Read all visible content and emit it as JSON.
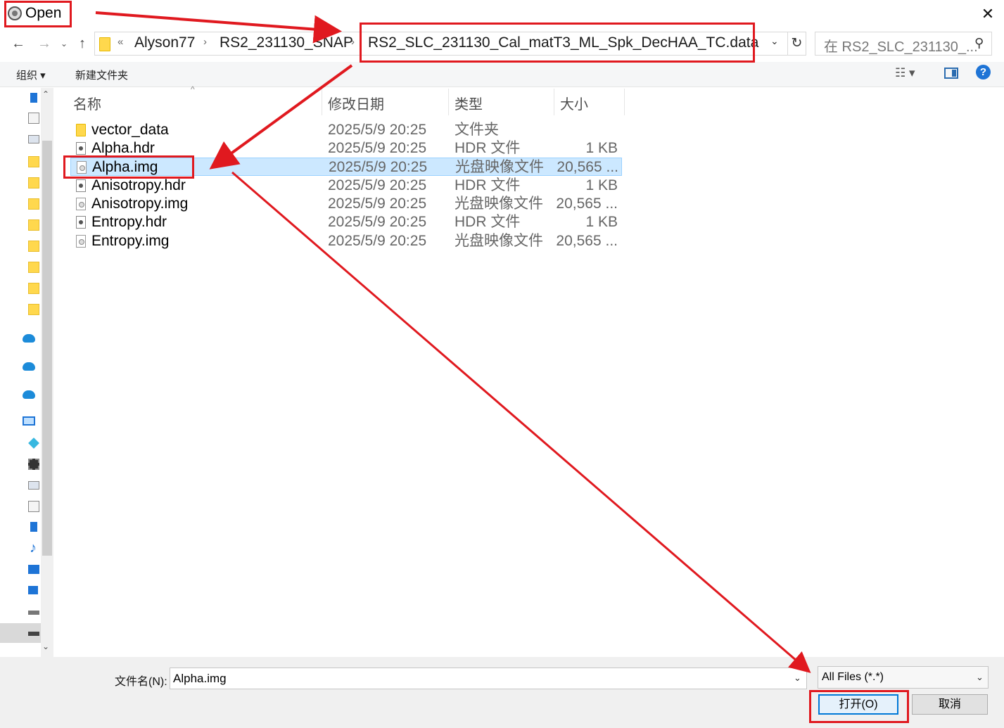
{
  "window": {
    "title": "Open",
    "close_glyph": "✕"
  },
  "nav": {
    "back_glyph": "←",
    "forward_glyph": "→",
    "recent_glyph": "⌄",
    "up_glyph": "↑"
  },
  "address": {
    "overflow": "«",
    "crumbs": [
      "Alyson77",
      "RS2_231130_SNAP",
      "RS2_SLC_231130_Cal_matT3_ML_Spk_DecHAA_TC.data"
    ],
    "separator": "›",
    "dropdown_glyph": "⌄",
    "refresh_glyph": "↻"
  },
  "search": {
    "placeholder": "在 RS2_SLC_231130_...",
    "icon": "search-icon"
  },
  "toolbar": {
    "organize_label": "组织 ▾",
    "new_folder_label": "新建文件夹",
    "view_glyph": "☷ ▾",
    "help_glyph": "?"
  },
  "columns": {
    "name": "名称",
    "date": "修改日期",
    "type": "类型",
    "size": "大小",
    "sort_glyph": "^"
  },
  "files": [
    {
      "name": "vector_data",
      "date": "2025/5/9 20:25",
      "type": "文件夹",
      "size": "",
      "icon": "folder",
      "selected": false
    },
    {
      "name": "Alpha.hdr",
      "date": "2025/5/9 20:25",
      "type": "HDR 文件",
      "size": "1 KB",
      "icon": "hdr",
      "selected": false
    },
    {
      "name": "Alpha.img",
      "date": "2025/5/9 20:25",
      "type": "光盘映像文件",
      "size": "20,565 ...",
      "icon": "img",
      "selected": true
    },
    {
      "name": "Anisotropy.hdr",
      "date": "2025/5/9 20:25",
      "type": "HDR 文件",
      "size": "1 KB",
      "icon": "hdr",
      "selected": false
    },
    {
      "name": "Anisotropy.img",
      "date": "2025/5/9 20:25",
      "type": "光盘映像文件",
      "size": "20,565 ...",
      "icon": "img",
      "selected": false
    },
    {
      "name": "Entropy.hdr",
      "date": "2025/5/9 20:25",
      "type": "HDR 文件",
      "size": "1 KB",
      "icon": "hdr",
      "selected": false
    },
    {
      "name": "Entropy.img",
      "date": "2025/5/9 20:25",
      "type": "光盘映像文件",
      "size": "20,565 ...",
      "icon": "img",
      "selected": false
    }
  ],
  "footer": {
    "filename_label": "文件名(N):",
    "filename_value": "Alpha.img",
    "filetype_value": "All Files (*.*)",
    "dropdown_glyph": "⌄",
    "open_label": "打开(O)",
    "cancel_label": "取消"
  },
  "colors": {
    "annotation_red": "#e0191f",
    "selection_bg": "#cce8ff",
    "accent_blue": "#0078d7"
  }
}
